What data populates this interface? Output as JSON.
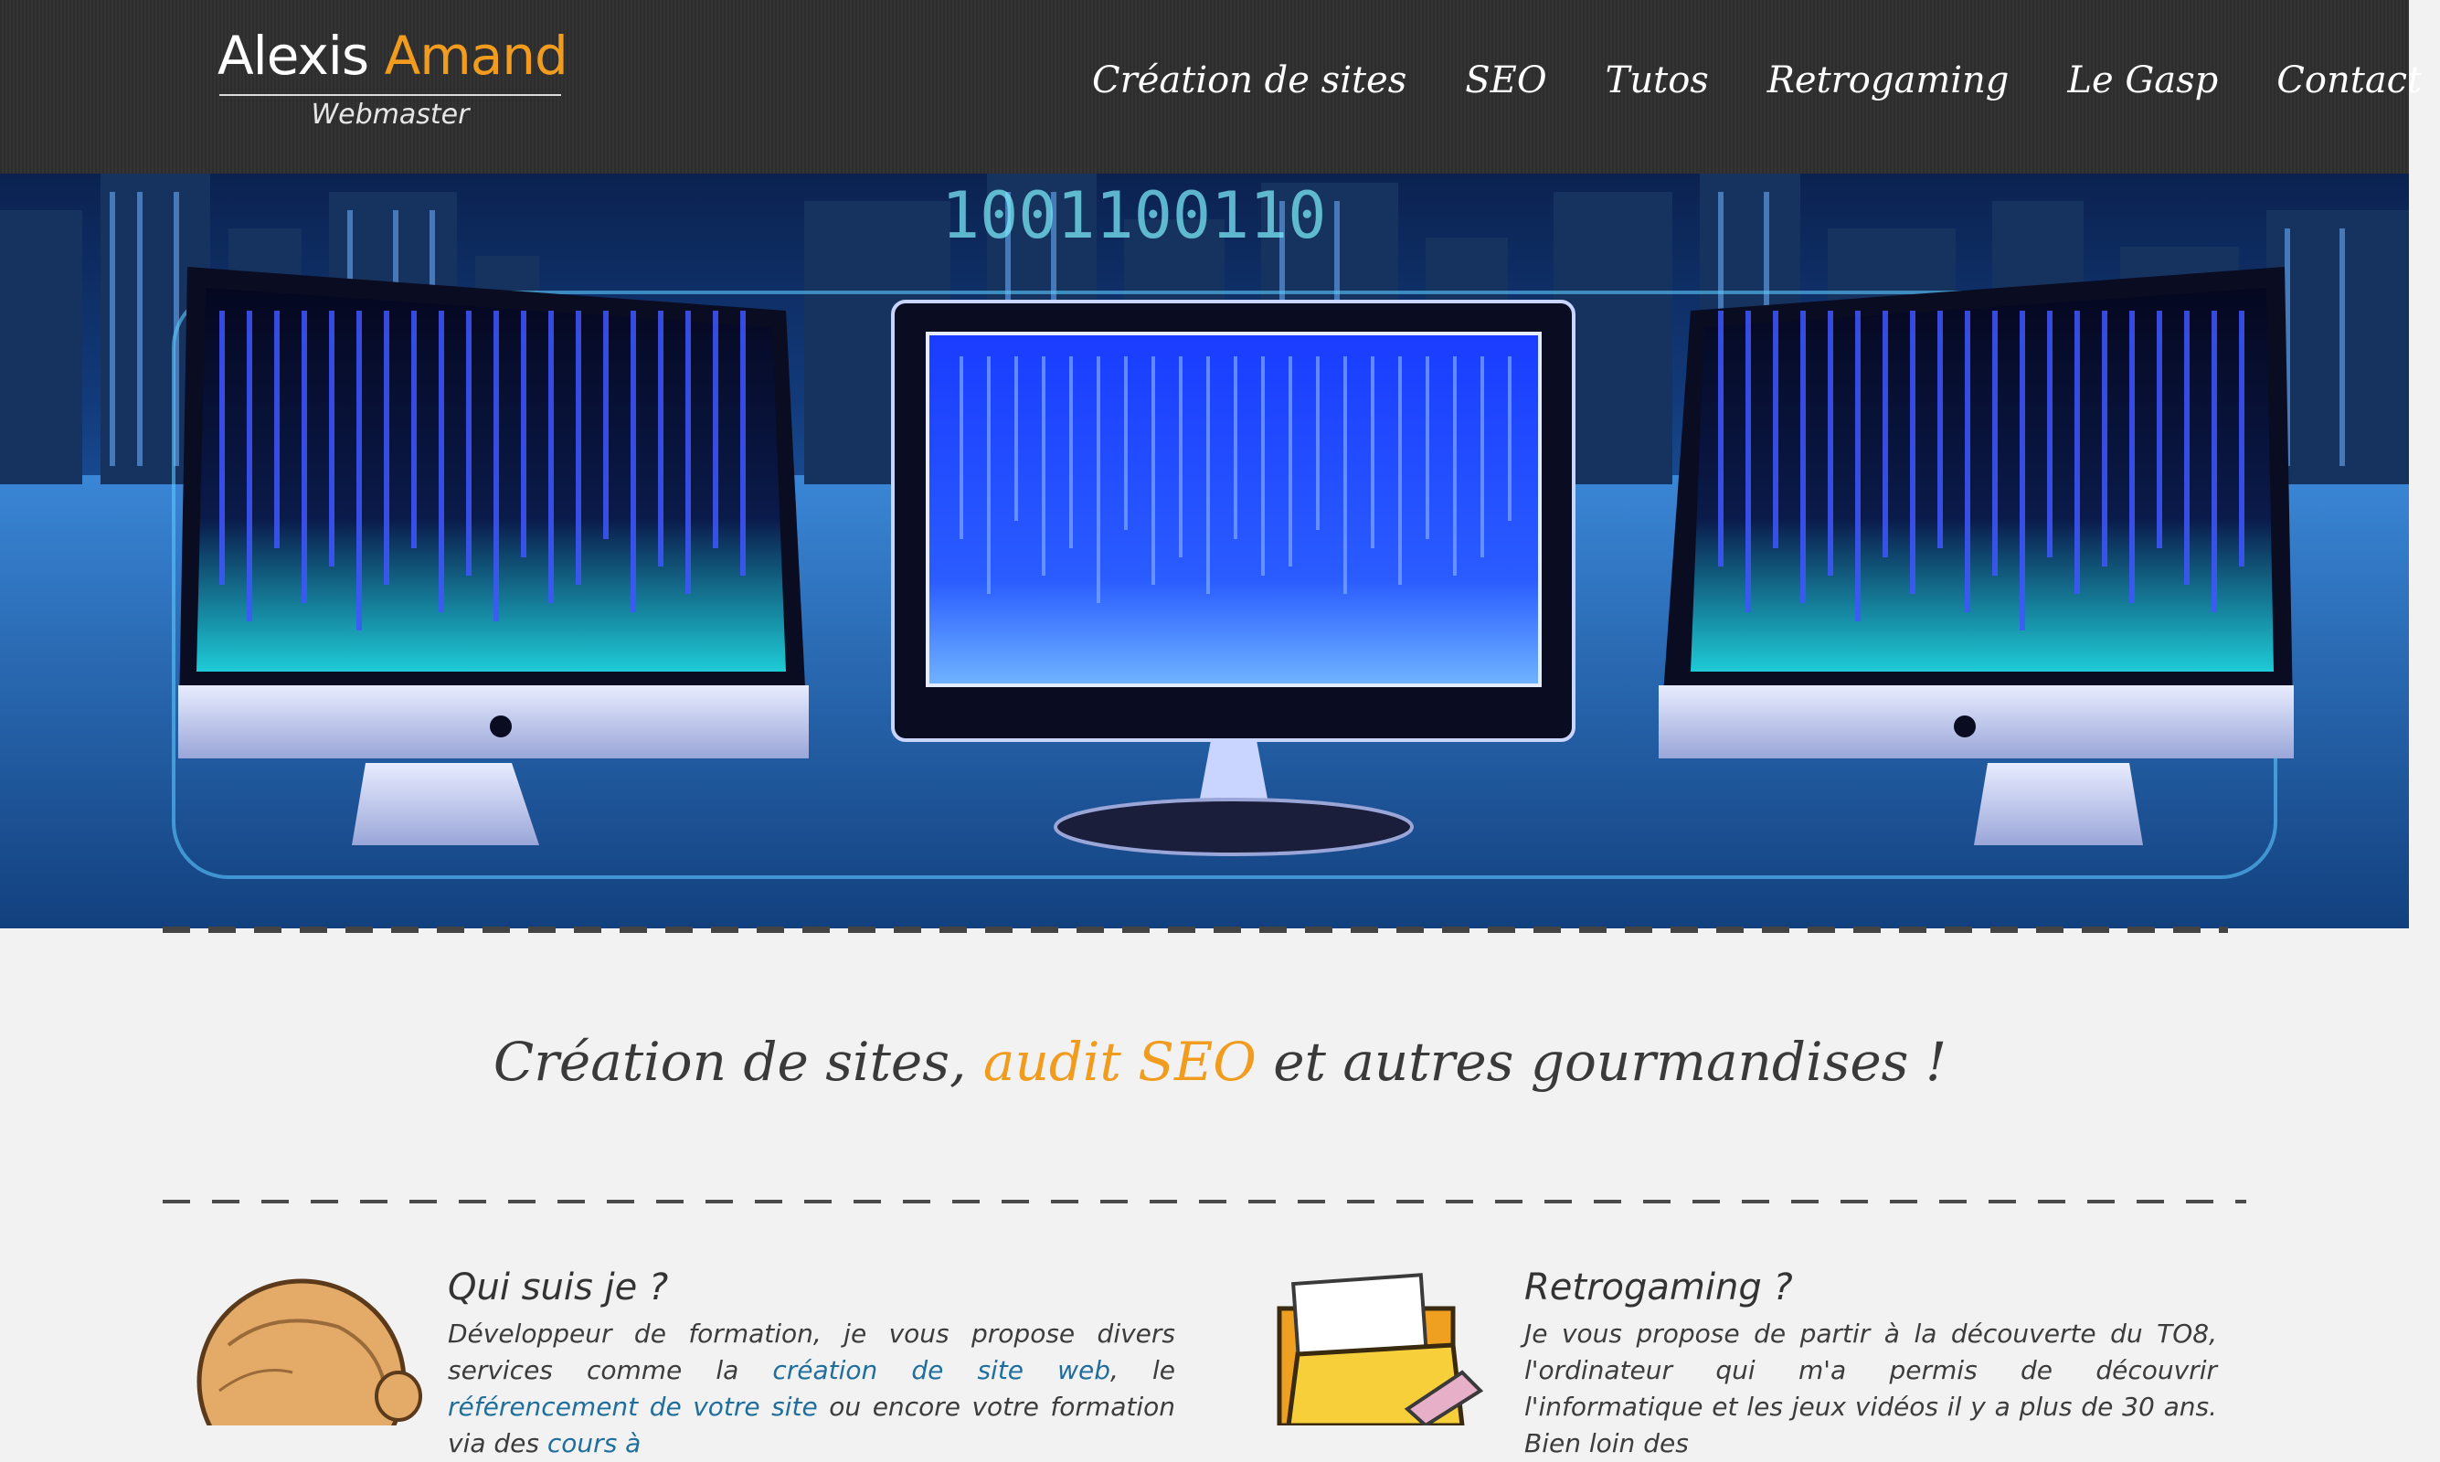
{
  "header": {
    "logo": {
      "first_name": "Alexis",
      "last_name": "Amand",
      "subtitle": "Webmaster"
    },
    "nav": [
      {
        "label": "Création de sites"
      },
      {
        "label": "SEO"
      },
      {
        "label": "Tutos"
      },
      {
        "label": "Retrogaming"
      },
      {
        "label": "Le Gasp"
      },
      {
        "label": "Contact"
      }
    ]
  },
  "hero": {
    "binary_text": "1001100110"
  },
  "main": {
    "tagline": {
      "before": "Création de sites, ",
      "accent": "audit SEO",
      "after": " et autres gourmandises !"
    },
    "cards": [
      {
        "title": "Qui suis je ?",
        "text_1": "Développeur de formation, je vous propose divers services comme la ",
        "link_1": "création de site web",
        "text_2": ", le ",
        "link_2": "référencement de votre site",
        "text_3": " ou encore votre formation via des ",
        "link_3": "cours à"
      },
      {
        "title": "Retrogaming ?",
        "text_1": "Je vous propose de partir à la découverte du TO8, l'ordinateur qui m'a permis de découvrir l'informatique et les jeux vidéos il y a plus de 30 ans. Bien loin des"
      }
    ]
  },
  "colors": {
    "accent": "#f29c1f",
    "header_bg": "#2f2f30",
    "link": "#1f6e9c",
    "page_bg": "#f2f2f2"
  }
}
